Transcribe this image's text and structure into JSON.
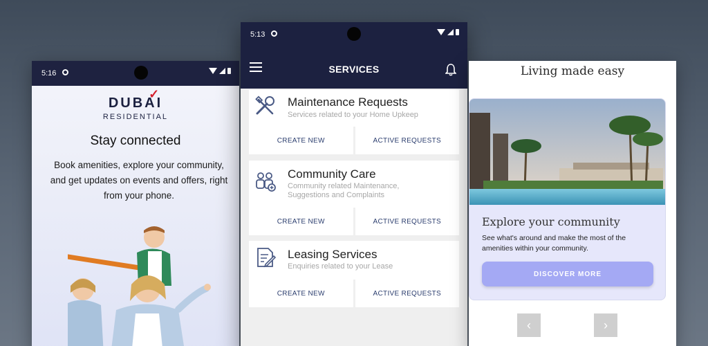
{
  "left": {
    "status_time": "5:16",
    "brand_name": "DUBAI",
    "brand_sub": "RESIDENTIAL",
    "heading": "Stay connected",
    "description": "Book amenities, explore your community, and get updates on events and offers, right from your phone."
  },
  "center": {
    "status_time": "5:13",
    "title": "SERVICES",
    "cards": [
      {
        "title": "Maintenance Requests",
        "subtitle": "Services related to your Home Upkeep",
        "create": "CREATE NEW",
        "active": "ACTIVE REQUESTS",
        "icon": "tools-icon"
      },
      {
        "title": "Community Care",
        "subtitle": "Community related Maintenance, Suggestions and Complaints",
        "create": "CREATE NEW",
        "active": "ACTIVE REQUESTS",
        "icon": "community-icon"
      },
      {
        "title": "Leasing Services",
        "subtitle": "Enquiries related to your Lease",
        "create": "CREATE NEW",
        "active": "ACTIVE REQUESTS",
        "icon": "lease-document-icon"
      }
    ]
  },
  "right": {
    "tagline": "Living made easy",
    "card_title": "Explore your community",
    "card_desc": "See what's around and make the most of the amenities within your community.",
    "cta": "DISCOVER MORE"
  },
  "colors": {
    "navy": "#1c2140",
    "accent": "#a4a9f4",
    "button_text": "#2c3e6f",
    "brand_red": "#d4202c"
  }
}
